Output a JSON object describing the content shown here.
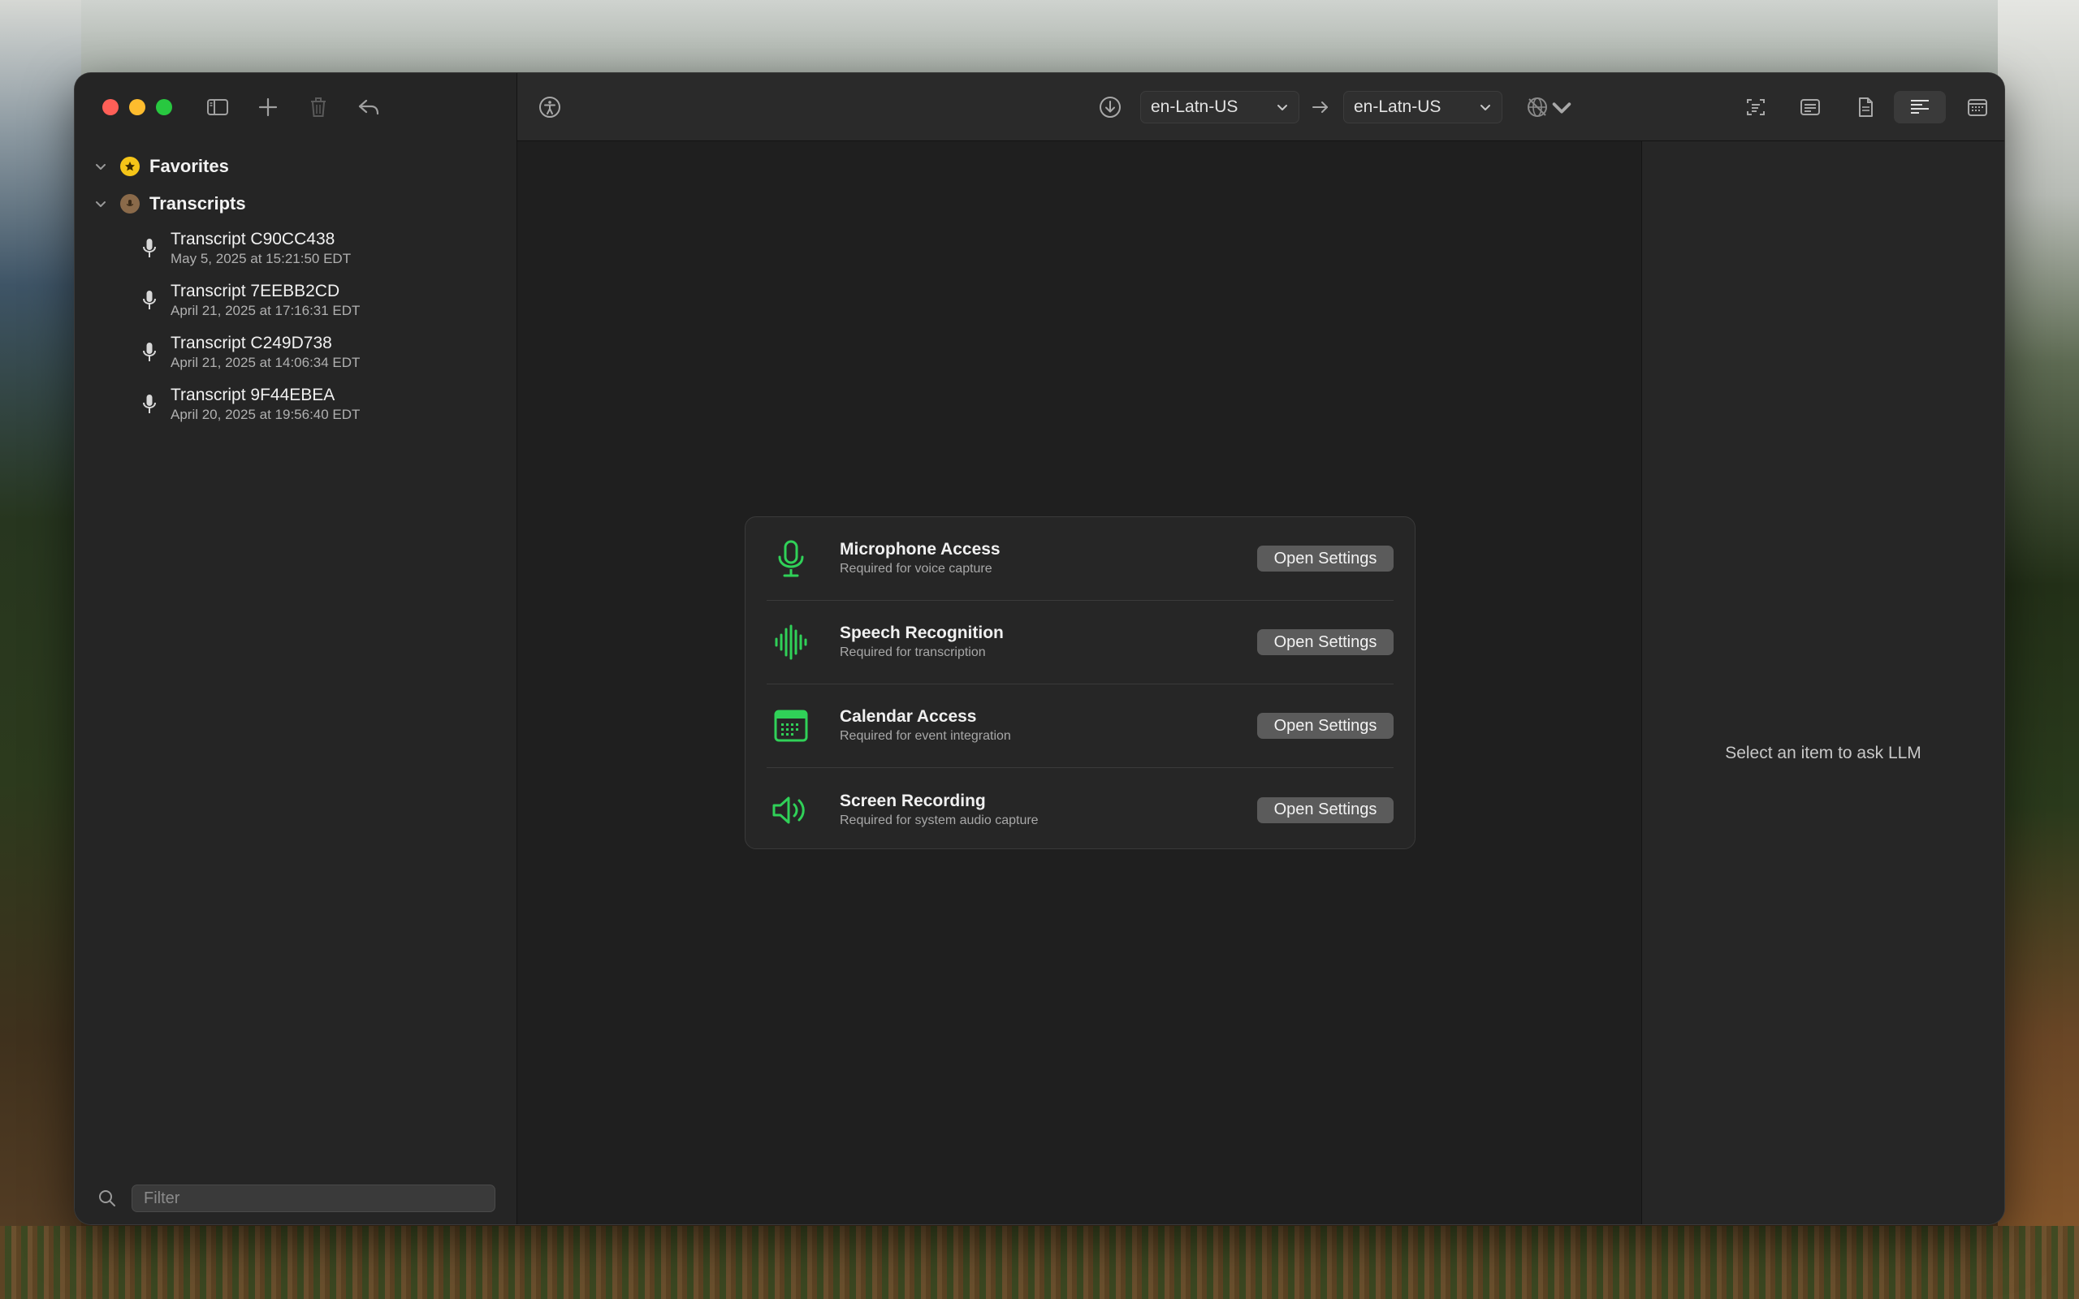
{
  "sidebar": {
    "sections": [
      {
        "label": "Favorites"
      },
      {
        "label": "Transcripts"
      }
    ],
    "transcripts": [
      {
        "title": "Transcript C90CC438",
        "date": "May 5, 2025 at 15:21:50 EDT"
      },
      {
        "title": "Transcript 7EEBB2CD",
        "date": "April 21, 2025 at 17:16:31 EDT"
      },
      {
        "title": "Transcript C249D738",
        "date": "April 21, 2025 at 14:06:34 EDT"
      },
      {
        "title": "Transcript 9F44EBEA",
        "date": "April 20, 2025 at 19:56:40 EDT"
      }
    ],
    "filter_placeholder": "Filter"
  },
  "toolbar": {
    "source_locale": "en-Latn-US",
    "target_locale": "en-Latn-US"
  },
  "permissions": [
    {
      "title": "Microphone Access",
      "subtitle": "Required for voice capture",
      "button": "Open Settings",
      "icon": "microphone-icon"
    },
    {
      "title": "Speech Recognition",
      "subtitle": "Required for transcription",
      "button": "Open Settings",
      "icon": "waveform-icon"
    },
    {
      "title": "Calendar Access",
      "subtitle": "Required for event integration",
      "button": "Open Settings",
      "icon": "calendar-icon"
    },
    {
      "title": "Screen Recording",
      "subtitle": "Required for system audio capture",
      "button": "Open Settings",
      "icon": "speaker-icon"
    }
  ],
  "right_panel": {
    "placeholder": "Select an item to ask LLM"
  },
  "colors": {
    "accent_green": "#30d158",
    "favorites_yellow": "#f5c518"
  }
}
